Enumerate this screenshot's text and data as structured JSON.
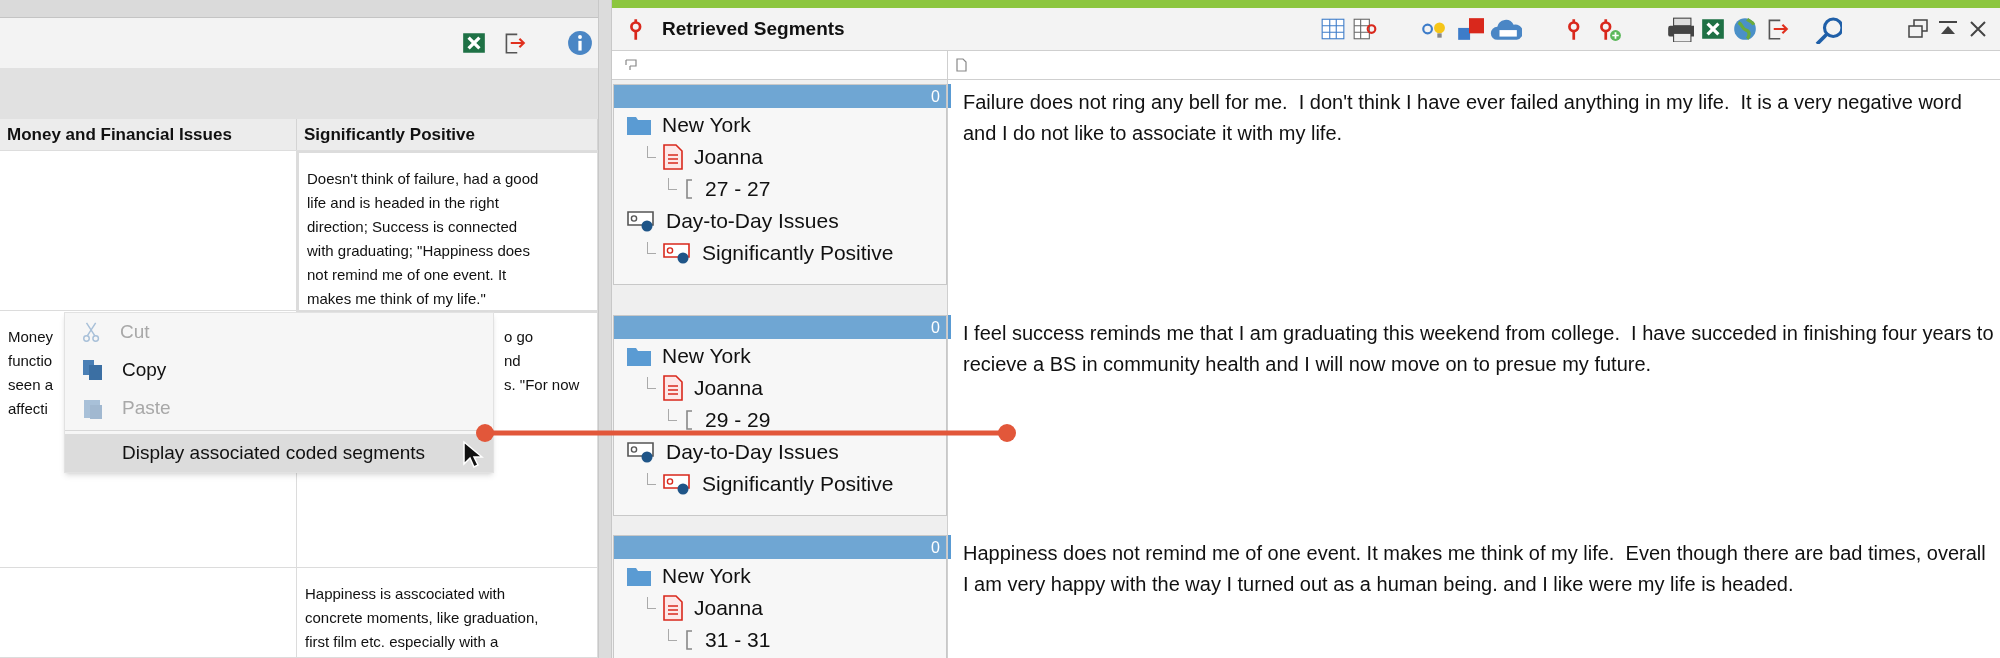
{
  "left_panel": {
    "table": {
      "columns": [
        "Money and Financial Issues",
        "Significantly Positive"
      ],
      "rows": [
        {
          "cells": [
            {
              "selected": false
            },
            {
              "lines": [
                "Doesn't think of failure, had a good",
                "life and is headed in the right",
                "direction; Success is connected",
                "with graduating; \"Happiness does",
                "not remind me of one event. It",
                "makes me think of my life.\""
              ],
              "selected": true
            }
          ]
        },
        {
          "cells": [
            {
              "lines": [
                "Money",
                "functio",
                "seen a",
                "affecti"
              ],
              "selected": false
            },
            {
              "lines": [
                "o go",
                "nd",
                "s. \"For now"
              ],
              "selected": false
            }
          ]
        },
        {
          "cells": [
            {
              "selected": false
            },
            {
              "lines": [
                "Happiness is asscociated with",
                "concrete moments, like graduation,",
                "first film etc. especially with a"
              ],
              "selected": false
            }
          ]
        }
      ]
    },
    "context_menu": {
      "items": [
        {
          "kind": "cut",
          "label": "Cut",
          "disabled": true,
          "selected": false
        },
        {
          "kind": "copy",
          "label": "Copy",
          "disabled": false,
          "selected": false
        },
        {
          "kind": "paste",
          "label": "Paste",
          "disabled": true,
          "selected": false
        },
        {
          "kind": "separator"
        },
        {
          "kind": "plain",
          "label": "Display associated coded segments",
          "disabled": false,
          "selected": true
        }
      ]
    }
  },
  "right_panel": {
    "title": "Retrieved Segments",
    "segments": [
      {
        "count": "0",
        "tree": [
          {
            "kind": "folder",
            "label": "New York",
            "children": [
              {
                "kind": "document",
                "label": "Joanna",
                "children": [
                  {
                    "kind": "range",
                    "label": "27 - 27"
                  }
                ]
              }
            ]
          },
          {
            "kind": "code",
            "label": "Day-to-Day Issues",
            "children": [
              {
                "kind": "subcode",
                "label": "Significantly Positive"
              }
            ]
          }
        ],
        "text": "Failure does not ring any bell for me.  I don't think I have ever failed anything in my life.  It is a very negative word and I do not like to associate it with my life."
      },
      {
        "count": "0",
        "tree": [
          {
            "kind": "folder",
            "label": "New York",
            "children": [
              {
                "kind": "document",
                "label": "Joanna",
                "children": [
                  {
                    "kind": "range",
                    "label": "29 - 29"
                  }
                ]
              }
            ]
          },
          {
            "kind": "code",
            "label": "Day-to-Day Issues",
            "children": [
              {
                "kind": "subcode",
                "label": "Significantly Positive"
              }
            ]
          }
        ],
        "text": "I feel success reminds me that I am graduating this weekend from college.  I have succeded in finishing four years to recieve a BS in community health and I will now move on to presue my future."
      },
      {
        "count": "0",
        "tree": [
          {
            "kind": "folder",
            "label": "New York",
            "children": [
              {
                "kind": "document",
                "label": "Joanna",
                "children": [
                  {
                    "kind": "range",
                    "label": "31 - 31"
                  }
                ]
              }
            ]
          }
        ],
        "text": "Happiness does not remind me of one event. It makes me think of my life.  Even though there are bad times, overall I am very happy with the way I turned out as a human being. and I like were my life is headed."
      }
    ]
  }
}
